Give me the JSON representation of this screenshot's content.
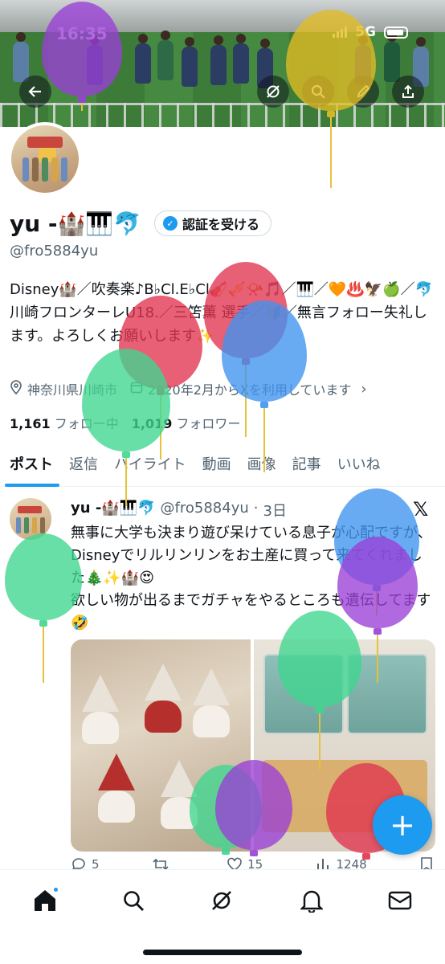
{
  "status_bar": {
    "time": "16:35",
    "network": "5G"
  },
  "profile": {
    "display_name": "yu -🏰🎹🐬",
    "verify_button_label": "認証を受ける",
    "handle": "@fro5884yu",
    "bio": "Disney🏰／吹奏楽♪B♭Cl.E♭Cl🎻🎺📯🎵／🎹／🧡♨️🦅🍏／🐬川崎フロンターレU18.／三笘薫 選手／🔰／無言フォロー失礼します。よろしくお願いします✨",
    "location": "神奈川県川崎市",
    "joined": "2020年2月からXを利用しています",
    "following_count": "1,161",
    "following_label": "フォロー中",
    "followers_count": "1,019",
    "followers_label": "フォロワー"
  },
  "tabs": [
    {
      "label": "ポスト",
      "active": true
    },
    {
      "label": "返信",
      "active": false
    },
    {
      "label": "ハイライト",
      "active": false
    },
    {
      "label": "動画",
      "active": false
    },
    {
      "label": "画像",
      "active": false
    },
    {
      "label": "記事",
      "active": false
    },
    {
      "label": "いいね",
      "active": false
    }
  ],
  "post": {
    "author": "yu -🏰🎹🐬",
    "handle": "@fro5884yu",
    "time": "3日",
    "text": "無事に大学も決まり遊び呆けている息子が心配ですが、Disneyでリルリンリンをお土産に買って来てくれました🎄✨🏰😍\n欲しい物が出るまでガチャをやるところも遺伝してます🤣",
    "reply_count": "5",
    "retweet_count": "",
    "like_count": "15",
    "view_count": "1248"
  },
  "colors": {
    "accent": "#1d9bf0",
    "text": "#0f1419",
    "muted": "#536471"
  },
  "icons": [
    "back-arrow-icon",
    "grok-icon",
    "search-icon",
    "edit-icon",
    "share-icon",
    "location-icon",
    "calendar-icon",
    "x-logo-icon",
    "reply-icon",
    "retweet-icon",
    "like-icon",
    "views-icon",
    "bookmark-icon",
    "compose-icon",
    "home-icon",
    "explore-icon",
    "grok-nav-icon",
    "notifications-icon",
    "messages-icon"
  ]
}
